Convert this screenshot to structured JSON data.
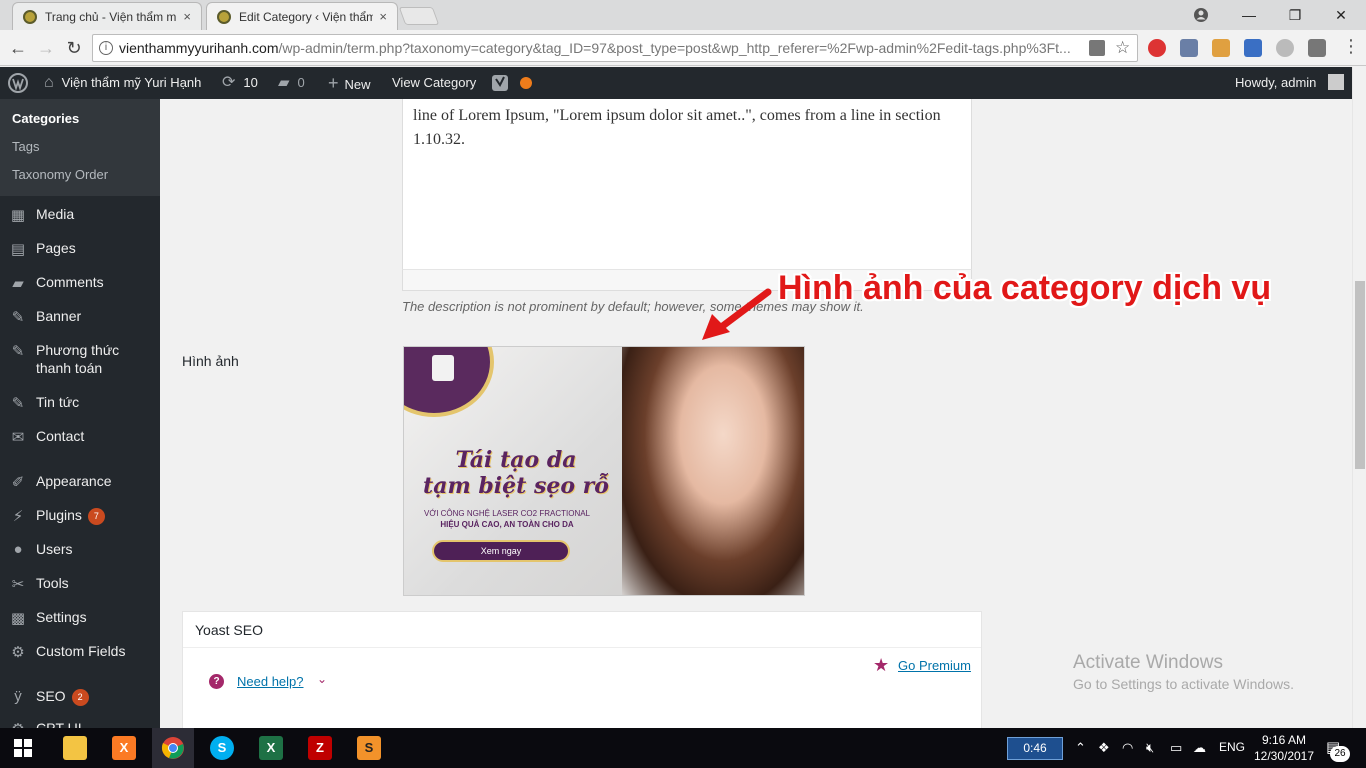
{
  "browser": {
    "tabs": [
      {
        "title": "Trang chủ - Viện thẩm m",
        "close": "×"
      },
      {
        "title": "Edit Category ‹ Viện thẩm",
        "close": "×"
      }
    ],
    "url_host": "vienthammyyurihanh.com",
    "url_path": "/wp-admin/term.php?taxonomy=category&tag_ID=97&post_type=post&wp_http_referer=%2Fwp-admin%2Fedit-tags.php%3Ft...",
    "window_controls": {
      "minimize": "—",
      "maximize": "❐",
      "close": "✕"
    }
  },
  "adminbar": {
    "site_name": "Viện thẩm mỹ Yuri Hạnh",
    "updates_count": "10",
    "comments_count": "0",
    "new_label": "New",
    "view_category": "View Category",
    "howdy": "Howdy, admin"
  },
  "sidebar": {
    "submenu": [
      "Categories",
      "Tags",
      "Taxonomy Order"
    ],
    "items": [
      {
        "label": "Media",
        "icon": "media-icon"
      },
      {
        "label": "Pages",
        "icon": "pages-icon"
      },
      {
        "label": "Comments",
        "icon": "comments-icon"
      },
      {
        "label": "Banner",
        "icon": "pin-icon"
      },
      {
        "label": "Phương thức thanh toán",
        "icon": "pin-icon"
      },
      {
        "label": "Tin tức",
        "icon": "pin-icon"
      },
      {
        "label": "Contact",
        "icon": "mail-icon"
      },
      {
        "label": "Appearance",
        "icon": "brush-icon"
      },
      {
        "label": "Plugins",
        "icon": "plug-icon",
        "badge": "7"
      },
      {
        "label": "Users",
        "icon": "user-icon"
      },
      {
        "label": "Tools",
        "icon": "wrench-icon"
      },
      {
        "label": "Settings",
        "icon": "settings-icon"
      },
      {
        "label": "Custom Fields",
        "icon": "gear-icon"
      },
      {
        "label": "SEO",
        "icon": "yoast-icon",
        "badge": "2"
      },
      {
        "label": "CPT UI",
        "icon": "gear-icon"
      }
    ]
  },
  "main": {
    "description_text": "line of Lorem Ipsum, \"Lorem ipsum dolor sit amet..\", comes from a line in section 1.10.32.",
    "description_hint": "The description is not prominent by default; however, some themes may show it.",
    "callout": "Hình ảnh của category dịch vụ",
    "image_label": "Hình ảnh",
    "banner": {
      "headline_1": "Tái tạo da",
      "headline_2": "tạm biệt sẹo rỗ",
      "sub_1": "VỚI CÔNG NGHỆ LASER CO2 FRACTIONAL",
      "sub_2": "HIỆU QUẢ CAO, AN TOÀN CHO DA",
      "button": "Xem ngay"
    },
    "yoast": {
      "title": "Yoast SEO",
      "need_help": "Need help?",
      "go_premium": "Go Premium"
    }
  },
  "watermark": {
    "line1": "Activate Windows",
    "line2": "Go to Settings to activate Windows."
  },
  "taskbar": {
    "timer": "0:46",
    "lang": "ENG",
    "time": "9:16 AM",
    "date": "12/30/2017",
    "notifications": "26"
  }
}
